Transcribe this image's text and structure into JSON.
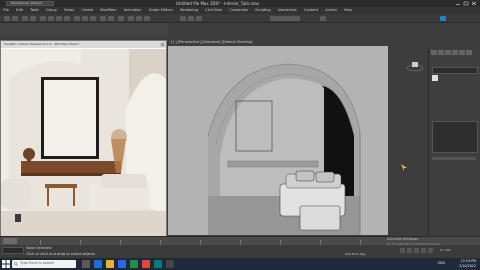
{
  "titlebar": {
    "title": "Untitled file Max 3DS* - Interior_Tuto.max",
    "workspace": "Workspaces: Default"
  },
  "menubar": {
    "items": [
      "File",
      "Edit",
      "Tools",
      "Group",
      "Views",
      "Create",
      "Modifiers",
      "Animation",
      "Graph Editors",
      "Rendering",
      "Civil View",
      "Customize",
      "Scripting",
      "Interactive",
      "Content",
      "Arnold",
      "Help"
    ]
  },
  "reference_window": {
    "title": "PureRef / Interior Reference 2.0 - 3DS Max Interior",
    "close": "×"
  },
  "viewport": {
    "label": "[+] [Perspective] [Standard] [Default Shading]"
  },
  "command_panel": {
    "object_name": "Line001",
    "section": "Modifier List"
  },
  "statusbar": {
    "selection": "None Selected",
    "prompt": "Click or click-and-drag to select objects",
    "add_time_tag": "Add Time Tag",
    "frame": "0 / 100"
  },
  "watermark": {
    "title": "Activate Windows",
    "subtitle": "Go to Settings to activate Windows."
  },
  "taskbar": {
    "search_placeholder": "Type here to search",
    "language": "ENG",
    "time": "12:19 PM",
    "date": "2/10/2022"
  },
  "colors": {
    "accent": "#4aa3df",
    "cursor": "#f2c200",
    "viewport_bg": "#a9a9a9"
  }
}
